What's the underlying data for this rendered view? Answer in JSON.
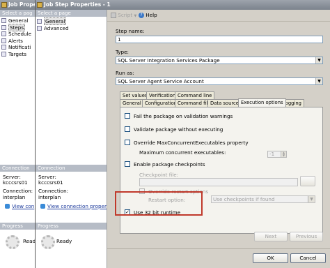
{
  "back_window": {
    "title": "Job Prope",
    "select_page_header": "Select a pag",
    "pages": [
      "General",
      "Steps",
      "Schedule",
      "Alerts",
      "Notificati",
      "Targets"
    ],
    "connection_header": "Connection",
    "server_label": "Server:",
    "server_value": "kcccsrs01",
    "connection_label": "Connection:",
    "connection_value": "interplan",
    "view_link": "View con",
    "progress_header": "Progress",
    "progress_status": "Read"
  },
  "window": {
    "title": "Job Step Properties - 1",
    "select_page_header": "Select a page",
    "pages": [
      {
        "label": "General",
        "selected": true
      },
      {
        "label": "Advanced",
        "selected": false
      }
    ],
    "connection_header": "Connection",
    "server_label": "Server:",
    "server_value": "kcccsrs01",
    "connection_label": "Connection:",
    "connection_value": "interplan",
    "view_link": "View connection properties",
    "progress_header": "Progress",
    "progress_status": "Ready",
    "toolbar": {
      "script": "Script",
      "help": "Help"
    },
    "form": {
      "step_name_label": "Step name:",
      "step_name_value": "1",
      "type_label": "Type:",
      "type_value": "SQL Server Integration Services Package",
      "run_as_label": "Run as:",
      "run_as_value": "SQL Server Agent Service Account"
    },
    "tabs_row1": [
      "Set values",
      "Verification",
      "Command line"
    ],
    "tabs_row2": [
      "General",
      "Configurations",
      "Command files",
      "Data sources",
      "Execution options",
      "Logging"
    ],
    "active_tab": "Execution options",
    "options": {
      "fail_package": {
        "label": "Fail the package on validation warnings",
        "checked": false
      },
      "validate": {
        "label": "Validate package without executing",
        "checked": false
      },
      "override_max": {
        "label": "Override MaxConcurrentExecutables property",
        "checked": false
      },
      "max_concurrent_label": "Maximum concurrent executables:",
      "max_concurrent_value": "-1",
      "enable_checkpoints": {
        "label": "Enable package checkpoints",
        "checked": false
      },
      "checkpoint_file_label": "Checkpoint file:",
      "override_restart": {
        "label": "Override restart options",
        "checked": false
      },
      "restart_option_label": "Restart option:",
      "restart_option_value": "Use checkpoints if found",
      "use_32bit": {
        "label": "Use 32 bit runtime",
        "checked": true
      }
    },
    "highlight_color": "#c0392b",
    "buttons": {
      "next": "Next",
      "previous": "Previous",
      "ok": "OK",
      "cancel": "Cancel"
    }
  }
}
